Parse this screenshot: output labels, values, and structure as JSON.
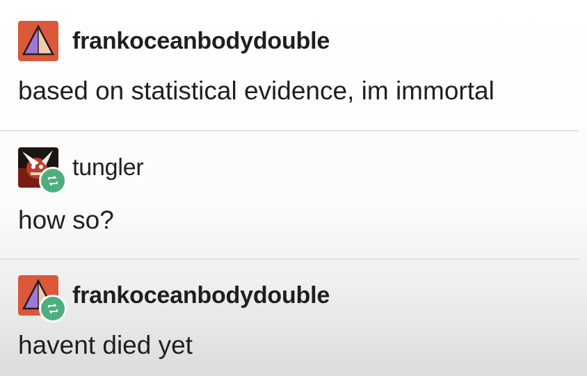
{
  "posts": [
    {
      "username": "frankoceanbodydouble",
      "text": "based on statistical evidence, im immortal",
      "avatar_icon": "pyramid-avatar",
      "reblog": false
    },
    {
      "username": "tungler",
      "text": "how so?",
      "avatar_icon": "character-avatar",
      "reblog": true
    },
    {
      "username": "frankoceanbodydouble",
      "text": "havent died yet",
      "avatar_icon": "pyramid-avatar",
      "reblog": true
    }
  ],
  "colors": {
    "avatar_orange": "#d9593a",
    "reblog_green": "#4caf7d",
    "divider": "#e2e2e2"
  }
}
